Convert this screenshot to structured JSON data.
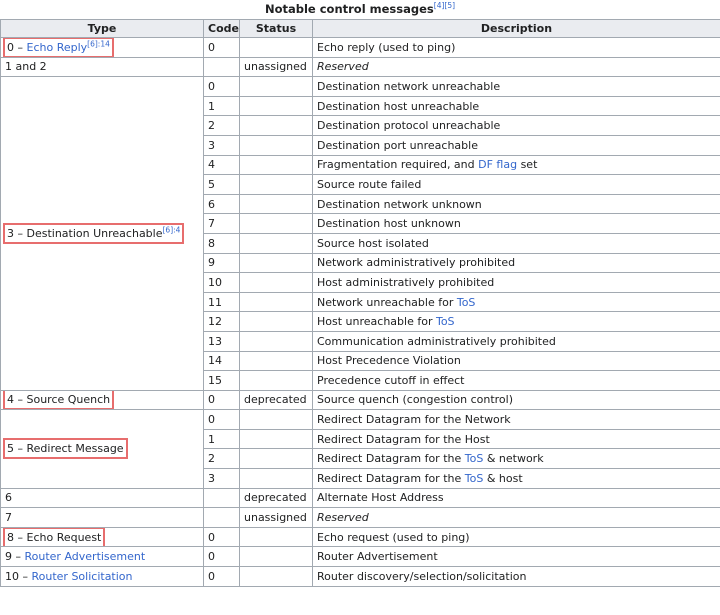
{
  "caption": {
    "title": "Notable control messages",
    "refs": "[4][5]"
  },
  "headers": {
    "type": "Type",
    "code": "Code",
    "status": "Status",
    "description": "Description"
  },
  "row_echo_reply": {
    "num": "0 – ",
    "link": "Echo Reply",
    "ref": "[6]:14",
    "code": "0",
    "status": "",
    "desc": "Echo reply (used to ping)"
  },
  "row_1_2": {
    "type": "1 and 2",
    "status": "unassigned",
    "desc": "Reserved"
  },
  "dest_unreach": {
    "label": "3 – Destination Unreachable",
    "ref": "[6]:4",
    "rows": [
      {
        "code": "0",
        "pre": "Destination network unreachable"
      },
      {
        "code": "1",
        "pre": "Destination host unreachable"
      },
      {
        "code": "2",
        "pre": "Destination protocol unreachable"
      },
      {
        "code": "3",
        "pre": "Destination port unreachable"
      },
      {
        "code": "4",
        "pre": "Fragmentation required, and ",
        "link": "DF flag",
        "post": " set"
      },
      {
        "code": "5",
        "pre": "Source route failed"
      },
      {
        "code": "6",
        "pre": "Destination network unknown"
      },
      {
        "code": "7",
        "pre": "Destination host unknown"
      },
      {
        "code": "8",
        "pre": "Source host isolated"
      },
      {
        "code": "9",
        "pre": "Network administratively prohibited"
      },
      {
        "code": "10",
        "pre": "Host administratively prohibited"
      },
      {
        "code": "11",
        "pre": "Network unreachable for ",
        "link": "ToS"
      },
      {
        "code": "12",
        "pre": "Host unreachable for ",
        "link": "ToS"
      },
      {
        "code": "13",
        "pre": "Communication administratively prohibited"
      },
      {
        "code": "14",
        "pre": "Host Precedence Violation"
      },
      {
        "code": "15",
        "pre": "Precedence cutoff in effect"
      }
    ]
  },
  "row_source_quench": {
    "label": "4 – Source Quench",
    "code": "0",
    "status": "deprecated",
    "desc": "Source quench (congestion control)"
  },
  "redirect": {
    "label": "5 – Redirect Message",
    "rows": [
      {
        "code": "0",
        "pre": "Redirect Datagram for the Network"
      },
      {
        "code": "1",
        "pre": "Redirect Datagram for the Host"
      },
      {
        "code": "2",
        "pre": "Redirect Datagram for the ",
        "link": "ToS",
        "post": " & network"
      },
      {
        "code": "3",
        "pre": "Redirect Datagram for the ",
        "link": "ToS",
        "post": " & host"
      }
    ]
  },
  "row_6": {
    "type": "6",
    "status": "deprecated",
    "desc": "Alternate Host Address"
  },
  "row_7": {
    "type": "7",
    "status": "unassigned",
    "desc": "Reserved"
  },
  "row_echo_request": {
    "label": "8 – Echo Request",
    "code": "0",
    "desc": "Echo request (used to ping)"
  },
  "row_router_adv": {
    "num": "9 – ",
    "link": "Router Advertisement",
    "code": "0",
    "desc": "Router Advertisement"
  },
  "row_router_sol": {
    "num": "10 – ",
    "link": "Router Solicitation",
    "code": "0",
    "desc": "Router discovery/selection/solicitation"
  },
  "colors": {
    "link": "#3366cc",
    "header_bg": "#eaecf0",
    "border": "#a2a9b1",
    "highlight": "#e76d6d"
  }
}
